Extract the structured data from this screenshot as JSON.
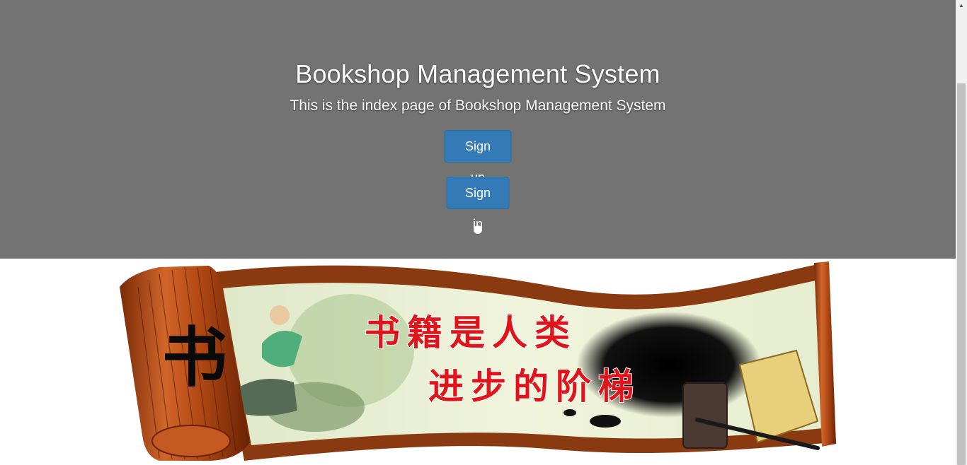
{
  "hero": {
    "title": "Bookshop Management System",
    "subtitle": "This is the index page of Bookshop Management System",
    "signup_label": "Sign up",
    "signin_label": "Sign in",
    "background_color": "#737373",
    "button_color": "#337ab7"
  },
  "banner": {
    "line1": "书籍是人类",
    "line2": "进步的阶梯",
    "scroll_char": "书"
  },
  "scrollbar": {
    "up_icon": "▲"
  }
}
